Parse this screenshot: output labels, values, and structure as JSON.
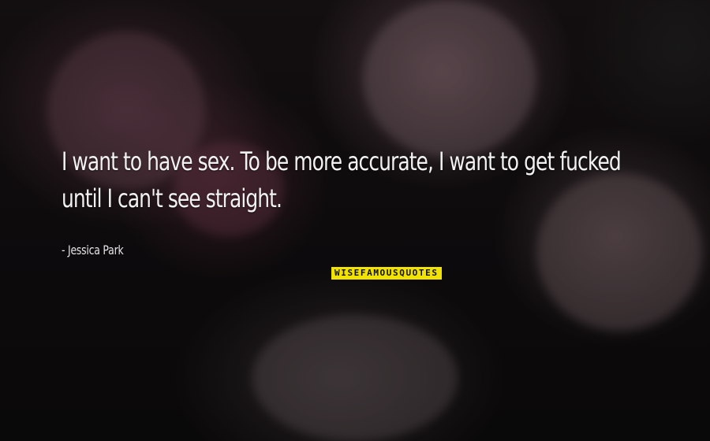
{
  "quote": {
    "text": "I want to have sex. To be more accurate, I want to get fucked until I can't see straight.",
    "author": "- Jessica Park"
  },
  "branding": {
    "logo_text": "WISEFAMOUSQUOTES",
    "logo_color": "#f2e200"
  }
}
